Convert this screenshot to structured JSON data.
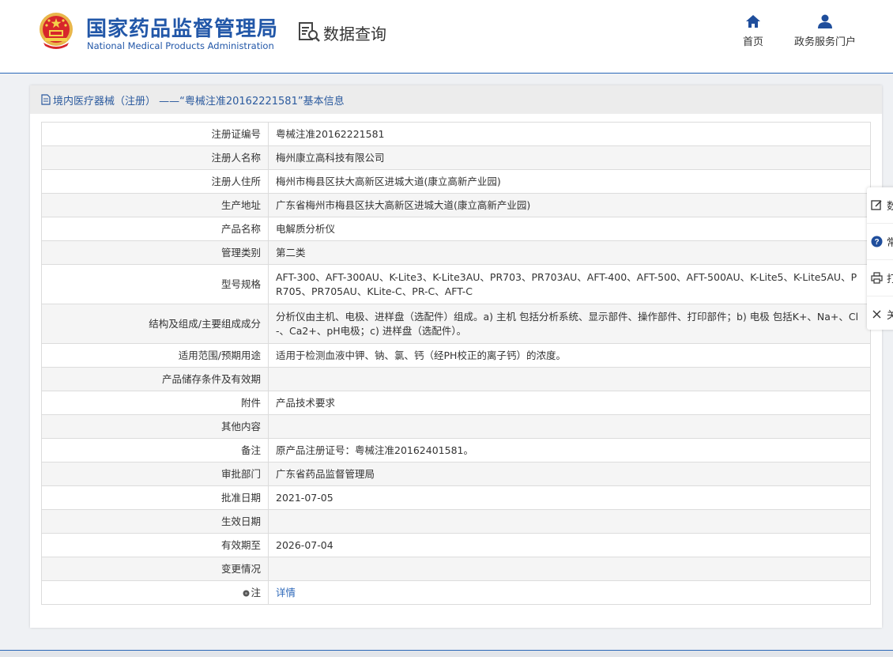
{
  "header": {
    "logo_cn": "国家药品监督管理局",
    "logo_en": "National Medical Products Administration",
    "query_label": "数据查询",
    "nav": [
      {
        "label": "首页",
        "icon": "home-icon"
      },
      {
        "label": "政务服务门户",
        "icon": "user-icon"
      }
    ]
  },
  "card": {
    "title": "境内医疗器械（注册） ——“粤械注准20162221581”基本信息"
  },
  "rows": [
    {
      "key": "注册证编号",
      "value": "粤械注准20162221581"
    },
    {
      "key": "注册人名称",
      "value": "梅州康立高科技有限公司"
    },
    {
      "key": "注册人住所",
      "value": "梅州市梅县区扶大高新区进城大道(康立高新产业园)"
    },
    {
      "key": "生产地址",
      "value": "广东省梅州市梅县区扶大高新区进城大道(康立高新产业园)"
    },
    {
      "key": "产品名称",
      "value": "电解质分析仪"
    },
    {
      "key": "管理类别",
      "value": "第二类"
    },
    {
      "key": "型号规格",
      "value": "AFT-300、AFT-300AU、K-Lite3、K-Lite3AU、PR703、PR703AU、AFT-400、AFT-500、AFT-500AU、K-Lite5、K-Lite5AU、PR705、PR705AU、KLite-C、PR-C、AFT-C"
    },
    {
      "key": "结构及组成/主要组成成分",
      "value": "分析仪由主机、电极、进样盘（选配件）组成。a) 主机 包括分析系统、显示部件、操作部件、打印部件；b) 电极 包括K+、Na+、Cl-、Ca2+、pH电极；c) 进样盘（选配件）。"
    },
    {
      "key": "适用范围/预期用途",
      "value": "适用于检测血液中钾、钠、氯、钙（经PH校正的离子钙）的浓度。"
    },
    {
      "key": "产品储存条件及有效期",
      "value": ""
    },
    {
      "key": "附件",
      "value": "产品技术要求"
    },
    {
      "key": "其他内容",
      "value": ""
    },
    {
      "key": "备注",
      "value": "原产品注册证号：粤械注准20162401581。"
    },
    {
      "key": "审批部门",
      "value": "广东省药品监督管理局"
    },
    {
      "key": "批准日期",
      "value": "2021-07-05"
    },
    {
      "key": "生效日期",
      "value": ""
    },
    {
      "key": "有效期至",
      "value": "2026-07-04"
    },
    {
      "key": "变更情况",
      "value": ""
    }
  ],
  "note_row": {
    "key": "注",
    "link": "详情"
  },
  "side_panel": [
    {
      "label": "数",
      "icon": "edit-icon"
    },
    {
      "label": "常",
      "icon": "help-icon"
    },
    {
      "label": "打",
      "icon": "print-icon"
    },
    {
      "label": "关",
      "icon": "close-icon"
    }
  ],
  "colors": {
    "brand": "#2257a8",
    "link": "#2b67b8",
    "title_bg": "#ececec",
    "row_alt": "#f5f5f5"
  }
}
